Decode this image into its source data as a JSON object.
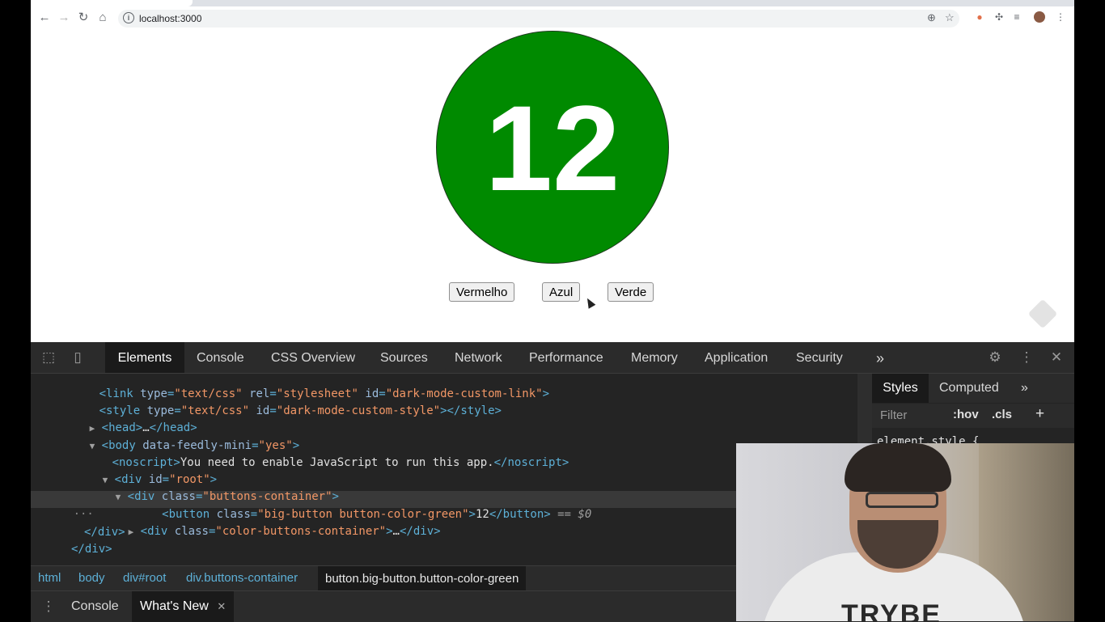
{
  "browser": {
    "url": "localhost:3000"
  },
  "app": {
    "counter": "12",
    "counter_color": "#008a00",
    "buttons": [
      "Vermelho",
      "Azul",
      "Verde"
    ]
  },
  "devtools": {
    "tabs": [
      "Elements",
      "Console",
      "CSS Overview",
      "Sources",
      "Network",
      "Performance",
      "Memory",
      "Application",
      "Security"
    ],
    "active_tab": "Elements",
    "more_tabs": "»",
    "dom_lines": [
      {
        "indent": 0,
        "tag_open": "<link ",
        "attrs": [
          [
            "type",
            "\"text/css\""
          ],
          [
            "rel",
            "\"stylesheet\""
          ],
          [
            "id",
            "\"dark-mode-custom-link\""
          ]
        ],
        "tail": ">"
      },
      {
        "indent": 0,
        "tag_open": "<style ",
        "attrs": [
          [
            "type",
            "\"text/css\""
          ],
          [
            "id",
            "\"dark-mode-custom-style\""
          ]
        ],
        "tail": "></style>"
      },
      {
        "text": "<head>…</head>"
      },
      {
        "text": "<body data-feedly-mini=\"yes\">"
      },
      {
        "text": "<noscript>You need to enable JavaScript to run this app.</noscript>"
      },
      {
        "text": "<div id=\"root\">"
      },
      {
        "text": "<div class=\"buttons-container\">"
      },
      {
        "text": "<button class=\"big-button button-color-green\">12</button> == $0"
      },
      {
        "text": "<div class=\"color-buttons-container\">…</div>"
      },
      {
        "text": "</div>"
      },
      {
        "text": "</div>"
      }
    ],
    "styles_tabs": [
      "Styles",
      "Computed"
    ],
    "styles_filter_placeholder": "Filter",
    "styles_hov": ":hov",
    "styles_cls": ".cls",
    "styles_first_rule": "element.style {",
    "breadcrumbs": [
      "html",
      "body",
      "div#root",
      "div.buttons-container",
      "button.big-button.button-color-green"
    ],
    "drawer_tabs": [
      "Console",
      "What's New"
    ]
  },
  "webcam": {
    "shirt_text": "TRYBE"
  }
}
